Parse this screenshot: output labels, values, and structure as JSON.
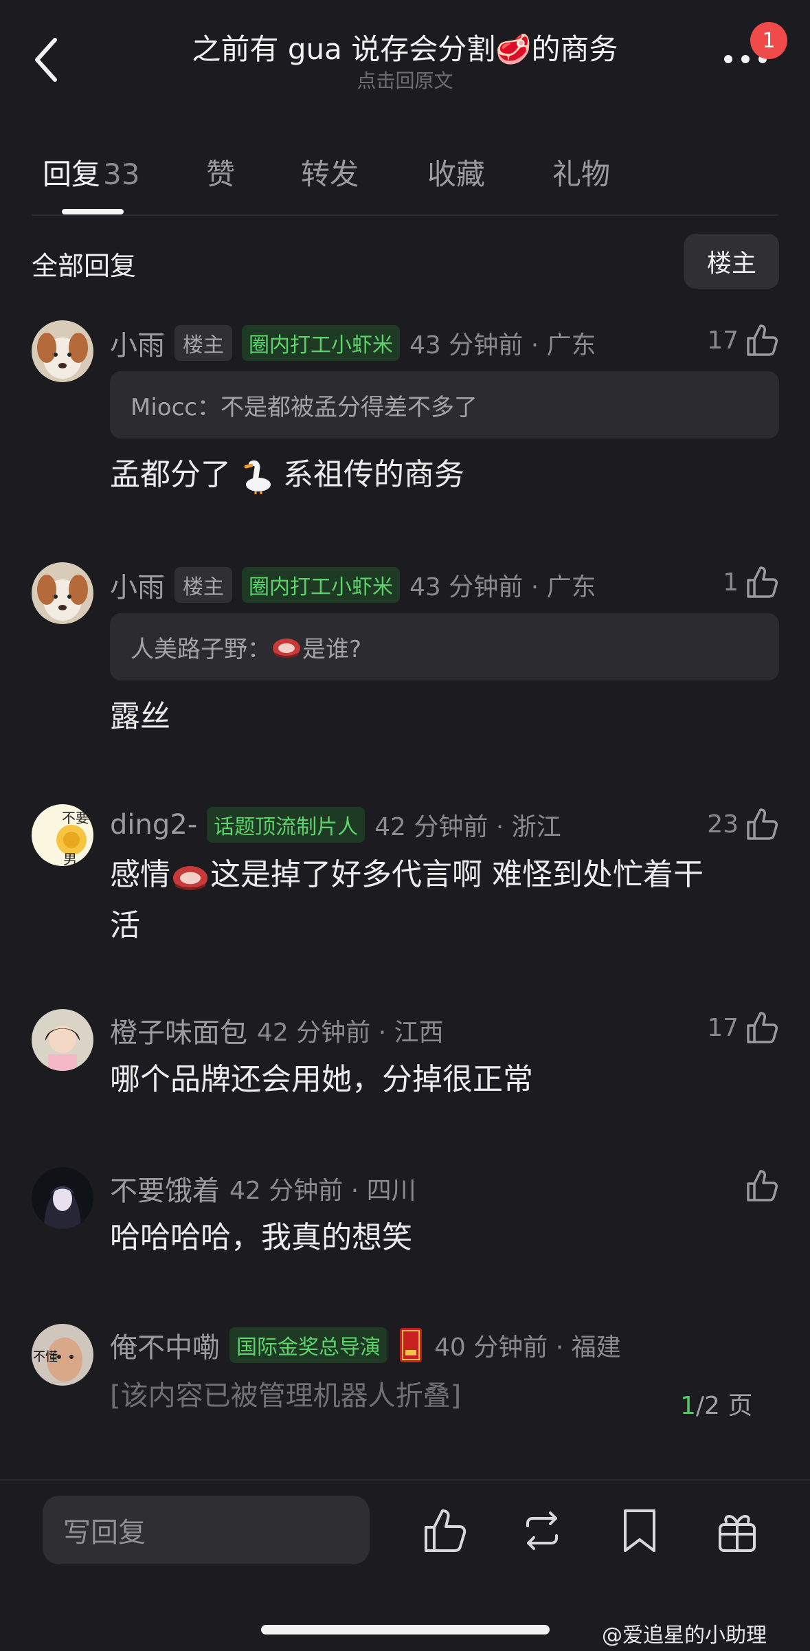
{
  "header": {
    "title": "之前有 gua 说存会分割🥩的商务",
    "subtitle": "点击回原文",
    "notification_count": "1",
    "back_icon": "chevron-left-icon",
    "more_icon": "more-dots-icon"
  },
  "tabs": [
    {
      "label": "回复",
      "count": "33",
      "active": true
    },
    {
      "label": "赞"
    },
    {
      "label": "转发"
    },
    {
      "label": "收藏"
    },
    {
      "label": "礼物"
    }
  ],
  "filter": {
    "all_label": "全部回复",
    "op_button": "楼主"
  },
  "comments": [
    {
      "user": "小雨",
      "op_tag": "楼主",
      "badge": "圈内打工小虾米",
      "time": "43 分钟前 · 广东",
      "likes": "17",
      "quote": "Miocc：不是都被孟分得差不多了",
      "text_a": "孟都分了",
      "text_b": "系祖传的商务"
    },
    {
      "user": "小雨",
      "op_tag": "楼主",
      "badge": "圈内打工小虾米",
      "time": "43 分钟前 · 广东",
      "likes": "1",
      "quote_a": "人美路子野：",
      "quote_b": "是谁?",
      "text": "露丝"
    },
    {
      "user": "ding2-",
      "badge": "话题顶流制片人",
      "time": "42 分钟前 · 浙江",
      "likes": "23",
      "text_a": "感情",
      "text_b": "这是掉了好多代言啊 难怪到处忙着干",
      "text_c": "活",
      "avatar_text_top": "不要",
      "avatar_text_bottom": "男"
    },
    {
      "user": "橙子味面包",
      "time": "42 分钟前 · 江西",
      "likes": "17",
      "text": "哪个品牌还会用她，分掉很正常"
    },
    {
      "user": "不要饿着",
      "time": "42 分钟前 · 四川",
      "likes": "",
      "text": "哈哈哈哈，我真的想笑"
    },
    {
      "user": "俺不中嘞",
      "badge": "国际金奖总导演",
      "time": "40 分钟前 · 福建",
      "text": "[该内容已被管理机器人折叠]",
      "avatar_text": "不懂"
    }
  ],
  "pager": {
    "current": "1",
    "total": "/2 页"
  },
  "bottom_bar": {
    "input_placeholder": "写回复",
    "icons": [
      "like-icon",
      "repost-icon",
      "bookmark-icon",
      "gift-icon"
    ]
  },
  "watermark": "@爱追星的小助理",
  "colors": {
    "background": "#1c1c20",
    "badge_green": "#5cd46a",
    "notification_red": "#f04a4a"
  }
}
